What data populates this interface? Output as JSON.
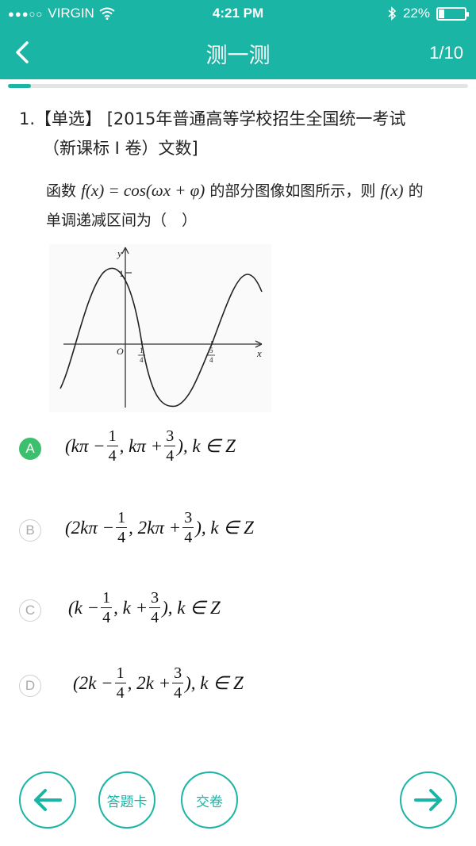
{
  "status_bar": {
    "carrier": "VIRGIN",
    "time": "4:21 PM",
    "battery_percent": "22%",
    "battery_level": 0.22,
    "signal_icon": "signal-dots-icon",
    "wifi_icon": "wifi-icon",
    "bluetooth_icon": "bluetooth-icon"
  },
  "nav": {
    "title": "测一测",
    "page_indicator": "1/10",
    "back_icon": "chevron-left-icon"
  },
  "progress": {
    "current": 1,
    "total": 10
  },
  "question": {
    "number_type": "1.【单选】",
    "source_line1": "[2015年普通高等学校招生全国统一考试",
    "source_line2": "（新课标 I 卷）文数]",
    "stem_prefix": "函数",
    "stem_func": "f(x) = cos(ωx + φ)",
    "stem_mid": "的部分图像如图所示，则",
    "stem_func2": "f(x)",
    "stem_suffix": "的",
    "stem_line2": "单调递减区间为（　）"
  },
  "graph": {
    "y_axis_label": "y",
    "x_axis_label": "x",
    "origin_label": "O",
    "y_tick": "1",
    "x_tick1_num": "1",
    "x_tick1_den": "4",
    "x_tick2_num": "5",
    "x_tick2_den": "4"
  },
  "options": [
    {
      "letter": "A",
      "selected": true,
      "prefix": "(kπ −",
      "n1": "1",
      "d1": "4",
      "mid": ", kπ +",
      "n2": "3",
      "d2": "4",
      "suffix": "), k ∈ Z"
    },
    {
      "letter": "B",
      "selected": false,
      "prefix": "(2kπ −",
      "n1": "1",
      "d1": "4",
      "mid": ", 2kπ +",
      "n2": "3",
      "d2": "4",
      "suffix": "), k ∈ Z"
    },
    {
      "letter": "C",
      "selected": false,
      "prefix": "(k −",
      "n1": "1",
      "d1": "4",
      "mid": ", k +",
      "n2": "3",
      "d2": "4",
      "suffix": "), k ∈ Z"
    },
    {
      "letter": "D",
      "selected": false,
      "prefix": "(2k −",
      "n1": "1",
      "d1": "4",
      "mid": ", 2k +",
      "n2": "3",
      "d2": "4",
      "suffix": "), k ∈ Z"
    }
  ],
  "footer": {
    "prev_icon": "arrow-left-icon",
    "answer_card_label": "答题卡",
    "submit_label": "交卷",
    "next_icon": "arrow-right-icon",
    "accent_color": "#1bb5a5",
    "selected_color": "#3cc06d"
  }
}
